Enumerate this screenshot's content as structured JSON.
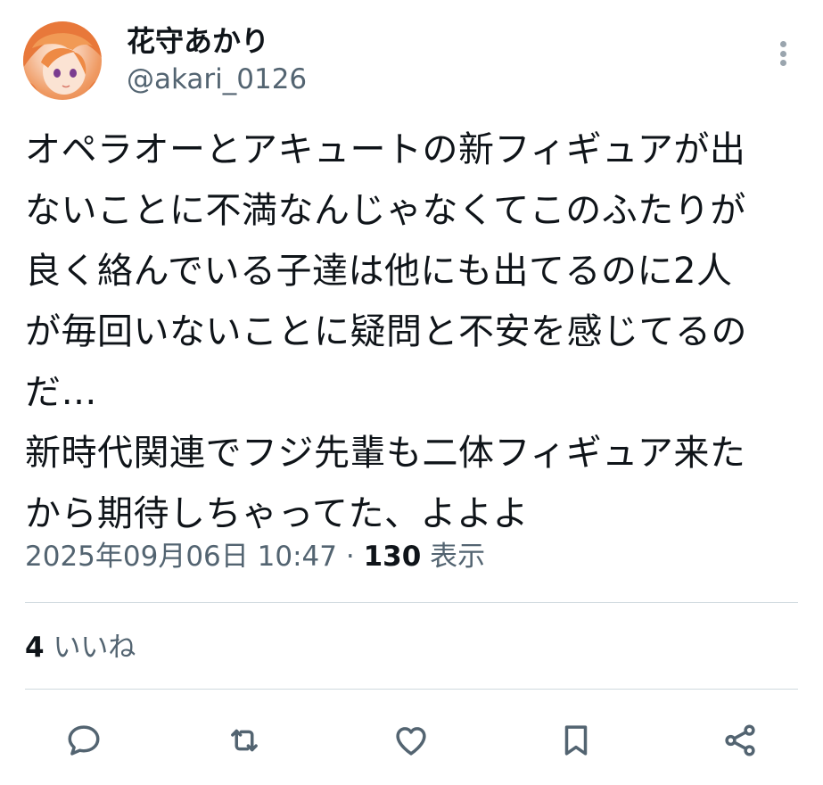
{
  "user": {
    "display_name": "花守あかり",
    "handle": "@akari_0126",
    "avatar_icon": "avatar-image"
  },
  "tweet": {
    "lines": [
      "オペラオーとアキュートの新フィギュアが出",
      "ないことに不満なんじゃなくてこのふたりが",
      "良く絡んでいる子達は他にも出てるのに2人",
      "が毎回いないことに疑問と不安を感じてるの",
      "だ…",
      "新時代関連でフジ先輩も二体フィギュア来た",
      "から期待しちゃってた、よよよ"
    ]
  },
  "meta": {
    "timestamp": "2025年09月06日 10:47",
    "separator": "·",
    "views_count": "130",
    "views_label": "表示"
  },
  "stats": {
    "likes_count": "4",
    "likes_label": "いいね"
  },
  "actions": {
    "icons": [
      "reply-icon",
      "retweet-icon",
      "like-icon",
      "bookmark-icon",
      "share-icon"
    ],
    "icon_color": "#536471"
  },
  "colors": {
    "text": "#0f1419",
    "secondary": "#536471",
    "divider": "#cfd9de"
  }
}
